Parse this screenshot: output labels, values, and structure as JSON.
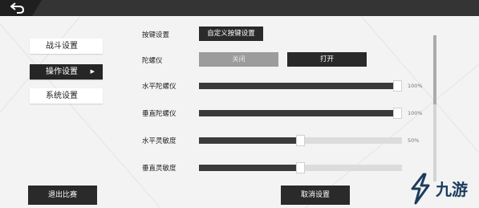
{
  "menu": {
    "items": [
      {
        "label": "战斗设置"
      },
      {
        "label": "操作设置",
        "arrow": "▶"
      },
      {
        "label": "系统设置"
      }
    ]
  },
  "settings": {
    "keybind": {
      "label": "按键设置",
      "button": "自定义按键设置"
    },
    "gyro": {
      "label": "陀螺仪",
      "off": "关闭",
      "on": "打开"
    },
    "sliders": [
      {
        "label": "水平陀螺仪",
        "value": 100,
        "value_text": "100%"
      },
      {
        "label": "垂直陀螺仪",
        "value": 100,
        "value_text": "100%"
      },
      {
        "label": "水平灵敏度",
        "value": 50,
        "value_text": "50%"
      },
      {
        "label": "垂直灵敏度",
        "value": 50,
        "value_text": ""
      }
    ]
  },
  "footer": {
    "exit_label": "退出比赛",
    "cancel_label": "取消设置"
  },
  "watermark": {
    "text": "九游"
  },
  "colors": {
    "dark": "#2a2a2a",
    "topbar": "#343434",
    "light_bg": "#f3f3f3"
  }
}
